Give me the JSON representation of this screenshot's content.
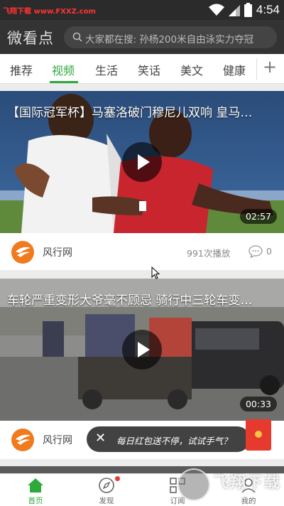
{
  "status_bar": {
    "watermark": "飞翔下载 www.FXXZ.com",
    "time": "4:54"
  },
  "header": {
    "app_title": "微看点",
    "search_placeholder": "大家都在搜: 孙杨200米自由泳实力夺冠"
  },
  "tabs": [
    {
      "label": "推荐",
      "active": false
    },
    {
      "label": "视频",
      "active": true
    },
    {
      "label": "生活",
      "active": false
    },
    {
      "label": "笑话",
      "active": false
    },
    {
      "label": "美文",
      "active": false
    },
    {
      "label": "健康",
      "active": false
    }
  ],
  "tab_add_label": "+",
  "feed": [
    {
      "title": "【国际冠军杯】马塞洛破门穆尼儿双响 皇马…",
      "duration": "02:57",
      "source": "风行网",
      "play_count": "991次播放",
      "comment_count": "0"
    },
    {
      "title": "车轮严重变形大爷毫不顾忌 骑行中三轮车变…",
      "duration": "00:33",
      "source": "风行网"
    }
  ],
  "toast": {
    "close": "✕",
    "text": "每日红包送不停，试试手气？"
  },
  "bottom_nav": [
    {
      "label": "首页",
      "icon": "home-icon",
      "active": true
    },
    {
      "label": "发现",
      "icon": "compass-icon",
      "active": false
    },
    {
      "label": "订阅",
      "icon": "subscribe-icon",
      "active": false
    },
    {
      "label": "我的",
      "icon": "profile-icon",
      "active": false
    }
  ],
  "watermark_logo": {
    "text": "飞翔下载",
    "url": "www.FXXZ.com"
  },
  "colors": {
    "accent": "#2eaa3c",
    "header_bg": "#333333",
    "source_logo": "#f07a1e",
    "red_packet": "#e63a2e"
  }
}
